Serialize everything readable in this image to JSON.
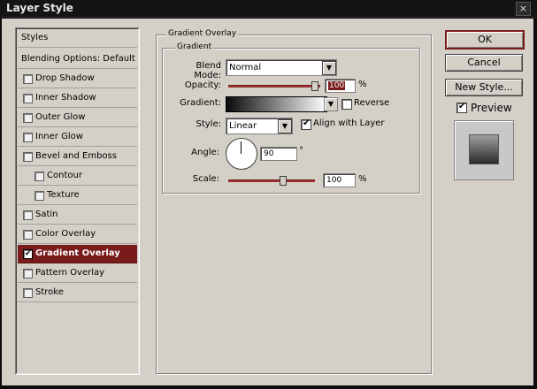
{
  "window": {
    "title": "Layer Style",
    "close_glyph": "×"
  },
  "left_panel": {
    "header": "Styles",
    "blending": "Blending Options: Default",
    "items": [
      {
        "label": "Drop Shadow",
        "checked": false
      },
      {
        "label": "Inner Shadow",
        "checked": false
      },
      {
        "label": "Outer Glow",
        "checked": false
      },
      {
        "label": "Inner Glow",
        "checked": false
      },
      {
        "label": "Bevel and Emboss",
        "checked": false
      },
      {
        "label": "Contour",
        "checked": false
      },
      {
        "label": "Texture",
        "checked": false
      },
      {
        "label": "Satin",
        "checked": false
      },
      {
        "label": "Color Overlay",
        "checked": false
      },
      {
        "label": "Gradient Overlay",
        "checked": true
      },
      {
        "label": "Pattern Overlay",
        "checked": false
      },
      {
        "label": "Stroke",
        "checked": false
      }
    ]
  },
  "gradient_overlay": {
    "group_title": "Gradient Overlay",
    "sub_title": "Gradient",
    "blend_mode_label": "Blend Mode:",
    "blend_mode_value": "Normal",
    "opacity_label": "Opacity:",
    "opacity_value": "100",
    "opacity_unit": "%",
    "gradient_label": "Gradient:",
    "reverse_label": "Reverse",
    "reverse_checked": false,
    "style_label": "Style:",
    "style_value": "Linear",
    "align_label": "Align with Layer",
    "align_checked": true,
    "angle_label": "Angle:",
    "angle_value": "90",
    "angle_unit": "°",
    "scale_label": "Scale:",
    "scale_value": "100",
    "scale_unit": "%",
    "check_glyph": "✔",
    "dropdown_glyph": "▼"
  },
  "buttons": {
    "ok": "OK",
    "cancel": "Cancel",
    "new_style": "New Style..."
  },
  "preview": {
    "label": "Preview",
    "checked": true
  },
  "colors": {
    "accent": "#7a1b1b",
    "panel": "#d4d0c8"
  }
}
